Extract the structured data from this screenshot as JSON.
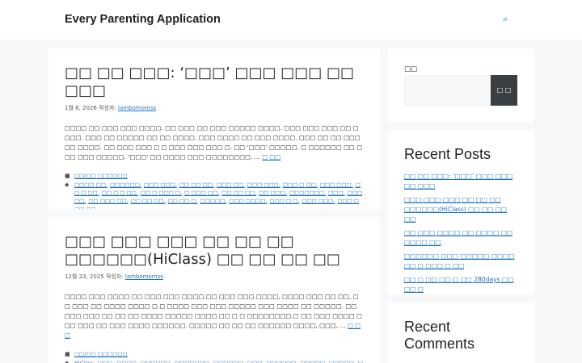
{
  "header": {
    "site_title": "Every Parenting Application",
    "search_icon": "search-icon"
  },
  "articles": [
    {
      "title": "□□ □□ □□□: ‘□□□’ □□□ □□□ □□ □□□",
      "date": "1월 8, 2026",
      "author_label": "작성자:",
      "author": "lambomomss",
      "summary": "□□□□ □□ □□□ □□□ □□□□. □□ □□□ □□ □□□ □□□□□ □□□□. □□□ □□□ □□□ □□ □□□□. □□□ □□ □□□□□ □□ □□ □□□□. □□□ □□□□ □□ □□□ □□□□. □□□ □□ □□ □□□ □□ □□□□. □□ □□□ □□□ □ □ □□□ □□□ □□□ □. □□ ‘□□□’ □□□□□. □ □□□□□□ □□ □ □□ □□□ □□□□□. ‘□□□’ □□ □□□□ □□□ □□□□□□□□. …",
      "read_more": "□ □□",
      "category": "□□/□□ □□□□□□",
      "tags": [
        "□□□□ □□",
        "□□□□□□",
        "□□□ □□□",
        "□□ □□ □□",
        "□□□ □□",
        "□□□ □□□",
        "□□□ □ □□",
        "□□□ □□□",
        "□□ □ □□",
        "□□ □ □ □□",
        "□□ □ □□□ □",
        "□ □□□ □□",
        "□□ □□ □□",
        "□□ □□□",
        "□□□□□□□",
        "□□□",
        "□□□ □□",
        "□□ □□□ □□",
        "□□ □□ □□",
        "□□ □□ □",
        "□□□□□",
        "□□□ □□□□",
        "□□□ □ □",
        "□□□ □□□",
        "□□□ □□□ □□"
      ],
      "comment_link": "□□ □□□□"
    },
    {
      "title": "□□□ □□□ □□□ □□ □□ □□ □□□□□□(HiClass) □□ □□ □□ □□",
      "date": "12월 23, 2025",
      "author_label": "작성자:",
      "author": "lambomomss",
      "summary": "□□□□ □□□ □□□□ □□ □□□ □□□ □□□□.□□ □□□ □□□ □□□□, □□□□ □□□ □□ □□, □□ □□□ □□ □□□□ □□□□ □.□ □□□□ □□□ □□□ □□□□□ □□□ □□□□ □□ □□□□□. □□ □□□ □□□ □□ □□ □□ □□□□ □□□□□ □□□□ □□ □ □ □□□□□□□□.□ □□ □□□ □□□□ □□□ □□□ □□ □□□ □□□□ □□□□□□. □□□□□ □□ □□ □□ □□□□□□ □□□□, □□□, …",
      "read_more": "□ □□",
      "category": "□□/□□ □□□□□□",
      "tags": [
        "HiClass",
        "□□□",
        "□□□□",
        "□□□□□□",
        "□□□□□□□",
        "□□□□□□",
        "□□□",
        "□□□□□□",
        "□□□□□",
        "□□□□□",
        "□□□□□",
        "□□□□□",
        "□□□□",
        "□□□□"
      ]
    }
  ],
  "sidebar": {
    "search_label": "□□",
    "search_button": "□ □",
    "recent_posts_title": "Recent Posts",
    "recent_posts": [
      "□□ □□ □□□: ‘□□□’ □□□ □□□ □□ □□□",
      "□□□ □□□ □□□ □□ □□ □□ □□□□□□(HiClass) □□ □□ □□ □□",
      "□□ □□□ □□□□ □□ □□□□ □□ □□□□ □□",
      "□□□□□□ □□□ □□□□□ □□□□ □□ □ □□□ □ □□",
      "□□ □ □□ □□ □ □□ 280days □□ □□ □"
    ],
    "recent_comments_title": "Recent Comments"
  }
}
